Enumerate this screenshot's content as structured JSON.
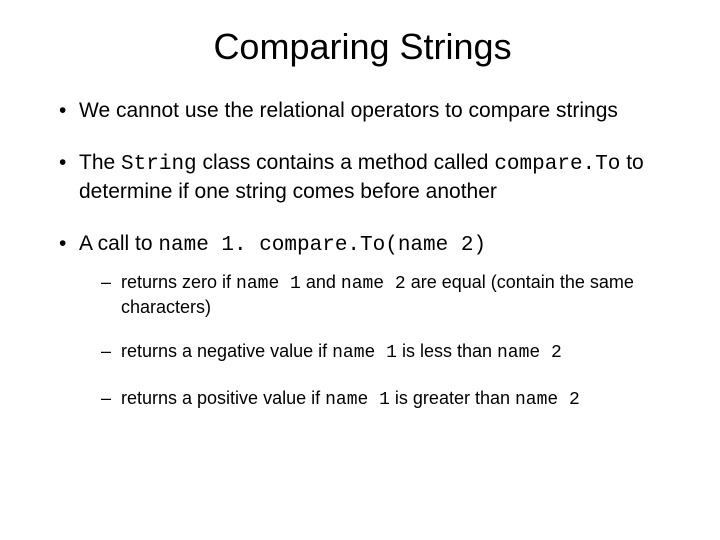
{
  "title": "Comparing Strings",
  "b1": "We cannot use the relational operators to compare strings",
  "b2a": "The ",
  "b2code1": "String",
  "b2b": " class contains a method called ",
  "b2code2": "compare.To",
  "b2c": " to determine if one string comes before another",
  "b3a": "A call to ",
  "b3code": "name 1. compare.To(name 2)",
  "s1a": "returns zero if ",
  "s1code1": "name 1",
  "s1b": " and ",
  "s1code2": "name 2",
  "s1c": " are equal (contain the same characters)",
  "s2a": "returns a negative value if ",
  "s2code1": "name 1",
  "s2b": " is less than ",
  "s2code2": "name 2",
  "s3a": "returns a positive value if ",
  "s3code1": "name 1",
  "s3b": " is greater than ",
  "s3code2": "name 2"
}
